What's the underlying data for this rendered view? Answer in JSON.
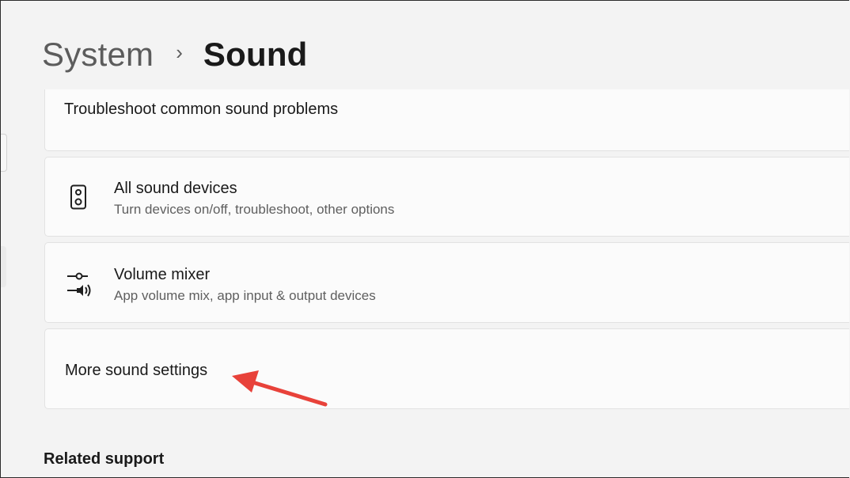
{
  "breadcrumb": {
    "parent": "System",
    "separator": "›",
    "current": "Sound"
  },
  "cards": {
    "troubleshoot": {
      "title": "Troubleshoot common sound problems"
    },
    "all_devices": {
      "icon": "speaker-icon",
      "title": "All sound devices",
      "subtitle": "Turn devices on/off, troubleshoot, other options"
    },
    "volume_mixer": {
      "icon": "volume-mixer-icon",
      "title": "Volume mixer",
      "subtitle": "App volume mix, app input & output devices"
    },
    "more_settings": {
      "title": "More sound settings"
    }
  },
  "related_support": {
    "heading": "Related support"
  },
  "colors": {
    "annotation_arrow": "#e8423a",
    "page_bg": "#f3f3f3",
    "card_bg": "#fbfbfb"
  }
}
